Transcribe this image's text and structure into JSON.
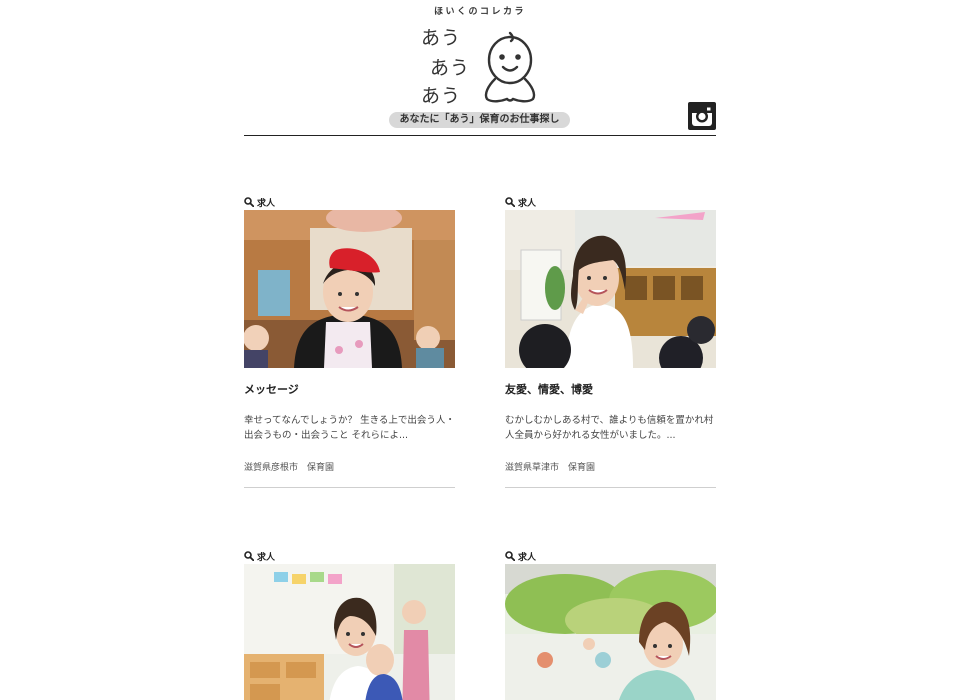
{
  "header": {
    "logo_top": "ほいくのコレカラ",
    "logo_lines": [
      "あう",
      "あう",
      "あう"
    ],
    "tagline": "あなたに「あう」保育のお仕事探し"
  },
  "colors": {
    "text": "#222222",
    "rule": "#222222",
    "card_rule": "#cfcfcf",
    "tagline_bg": "#d8d8d8"
  },
  "icons": {
    "instagram": "instagram-icon",
    "search": "search-icon",
    "mascot": "baby-face-mascot"
  },
  "cards": [
    {
      "category": "求人",
      "title": "メッセージ",
      "excerpt": "幸せってなんでしょうか？ 生きる上で出会う人・出会うもの・出会うこと それらによ...",
      "meta": "滋賀県彦根市　保育園"
    },
    {
      "category": "求人",
      "title": "友愛、情愛、博愛",
      "excerpt": "むかしむかしある村で、誰よりも信頼を置かれ村人全員から好かれる女性がいました。...",
      "meta": "滋賀県草津市　保育園"
    },
    {
      "category": "求人"
    },
    {
      "category": "求人"
    }
  ]
}
